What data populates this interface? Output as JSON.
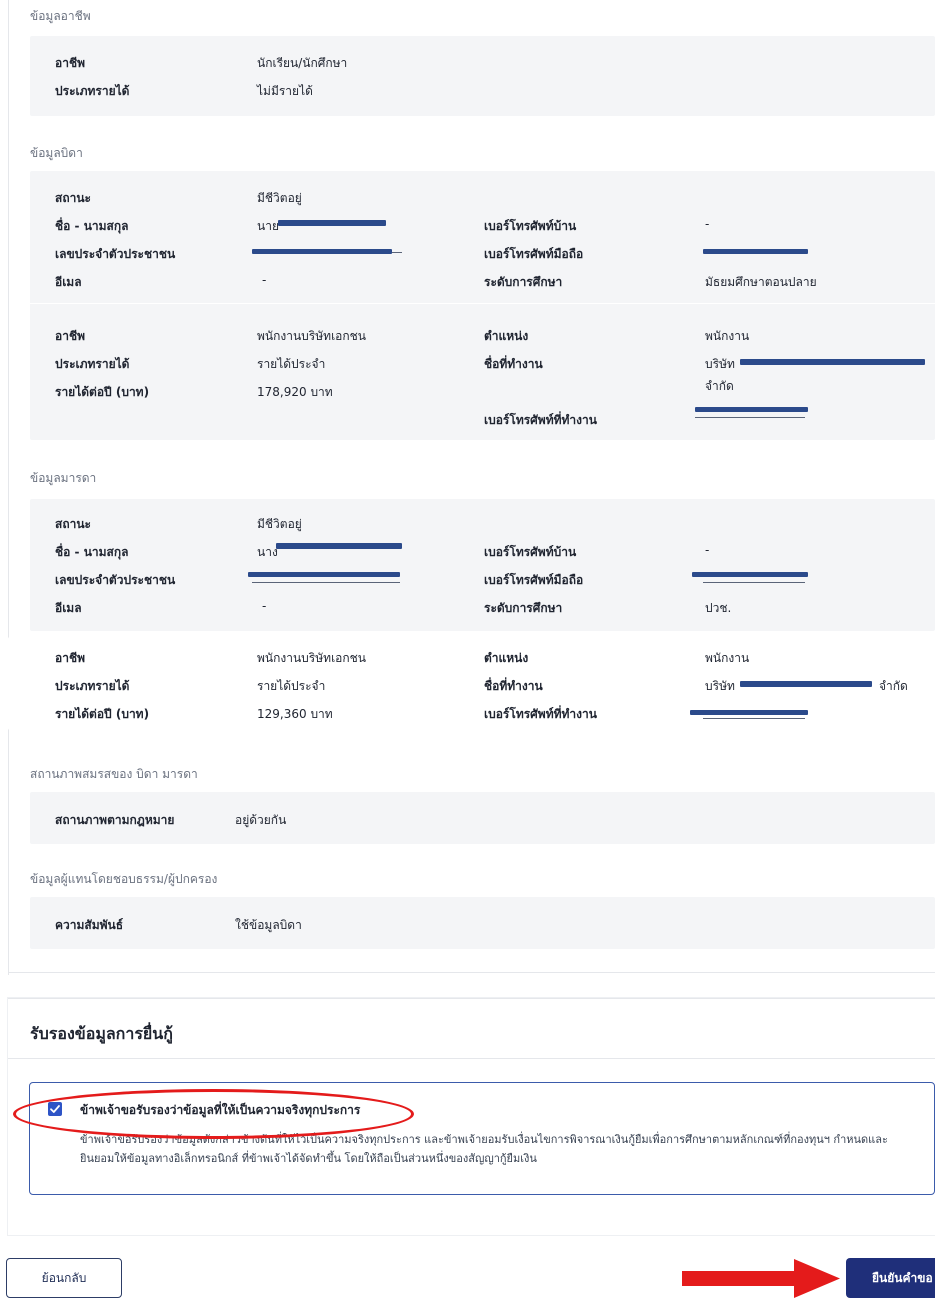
{
  "occupation_section": {
    "heading": "ข้อมูลอาชีพ",
    "occupation_label": "อาชีพ",
    "occupation_value": "นักเรียน/นักศึกษา",
    "income_type_label": "ประเภทรายได้",
    "income_type_value": "ไม่มีรายได้"
  },
  "father_section": {
    "heading": "ข้อมูลบิดา",
    "status_label": "สถานะ",
    "status_value": "มีชีวิตอยู่",
    "name_label": "ชื่อ - นามสกุล",
    "name_value": "นาย",
    "home_phone_label": "เบอร์โทรศัพท์บ้าน",
    "home_phone_value": "-",
    "id_label": "เลขประจำตัวประชาชน",
    "mobile_label": "เบอร์โทรศัพท์มือถือ",
    "email_label": "อีเมล",
    "email_value": "-",
    "education_label": "ระดับการศึกษา",
    "education_value": "มัธยมศึกษาตอนปลาย",
    "occupation_label": "อาชีพ",
    "occupation_value": "พนักงานบริษัทเอกชน",
    "position_label": "ตำแหน่ง",
    "position_value": "พนักงาน",
    "income_type_label": "ประเภทรายได้",
    "income_type_value": "รายได้ประจำ",
    "workplace_label": "ชื่อที่ทำงาน",
    "workplace_value": "บริษัท",
    "workplace_value_2": "จำกัด",
    "annual_income_label": "รายได้ต่อปี (บาท)",
    "annual_income_value": "178,920 บาท",
    "work_phone_label": "เบอร์โทรศัพท์ที่ทำงาน"
  },
  "mother_section": {
    "heading": "ข้อมูลมารดา",
    "status_label": "สถานะ",
    "status_value": "มีชีวิตอยู่",
    "name_label": "ชื่อ - นามสกุล",
    "name_value": "นาง",
    "home_phone_label": "เบอร์โทรศัพท์บ้าน",
    "home_phone_value": "-",
    "id_label": "เลขประจำตัวประชาชน",
    "mobile_label": "เบอร์โทรศัพท์มือถือ",
    "email_label": "อีเมล",
    "email_value": "-",
    "education_label": "ระดับการศึกษา",
    "education_value": "ปวช.",
    "occupation_label": "อาชีพ",
    "occupation_value": "พนักงานบริษัทเอกชน",
    "position_label": "ตำแหน่ง",
    "position_value": "พนักงาน",
    "income_type_label": "ประเภทรายได้",
    "income_type_value": "รายได้ประจำ",
    "workplace_label": "ชื่อที่ทำงาน",
    "workplace_value": "บริษัท",
    "workplace_suffix": "จำกัด",
    "annual_income_label": "รายได้ต่อปี (บาท)",
    "annual_income_value": "129,360 บาท",
    "work_phone_label": "เบอร์โทรศัพท์ที่ทำงาน"
  },
  "marital_section": {
    "heading": "สถานภาพสมรสของ บิดา มารดา",
    "legal_status_label": "สถานภาพตามกฎหมาย",
    "legal_status_value": "อยู่ด้วยกัน"
  },
  "guardian_section": {
    "heading": "ข้อมูลผู้แทนโดยชอบธรรม/ผู้ปกครอง",
    "relation_label": "ความสัมพันธ์",
    "relation_value": "ใช้ข้อมูลบิดา"
  },
  "certify_section": {
    "title": "รับรองข้อมูลการยื่นกู้",
    "checkbox_label": "ข้าพเจ้าขอรับรองว่าข้อมูลที่ให้เป็นความจริงทุกประการ",
    "checkbox_checked": true,
    "detail_text": "ข้าพเจ้าขอรับรองว่าข้อมูลดังกล่าวข้างต้นที่ให้ไว้เป็นความจริงทุกประการ และข้าพเจ้ายอมรับเงื่อนไขการพิจารณาเงินกู้ยืมเพื่อการศึกษาตามหลักเกณฑ์ที่กองทุนฯ กำหนดและยินยอมให้ข้อมูลทางอิเล็กทรอนิกส์ ที่ข้าพเจ้าได้จัดทำขึ้น โดยให้ถือเป็นส่วนหนึ่งของสัญญากู้ยืมเงิน"
  },
  "actions": {
    "back_label": "ย้อนกลับ",
    "confirm_label": "ยืนยันคำขอ"
  },
  "colors": {
    "primary": "#1f2f7a",
    "annotation_red": "#e41b1b",
    "redaction": "#2b4a8b"
  }
}
